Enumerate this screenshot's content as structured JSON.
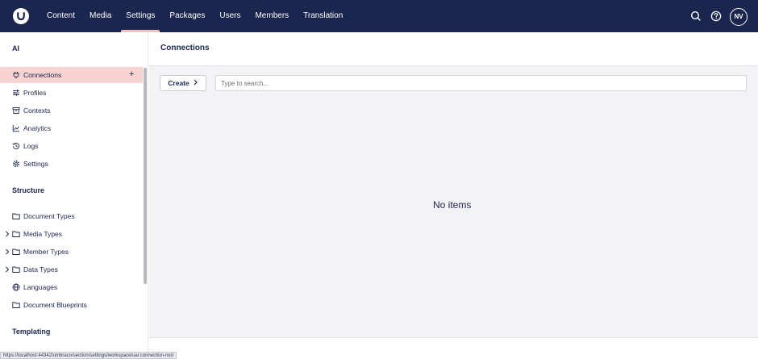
{
  "topbar": {
    "nav": [
      {
        "label": "Content",
        "active": false
      },
      {
        "label": "Media",
        "active": false
      },
      {
        "label": "Settings",
        "active": true
      },
      {
        "label": "Packages",
        "active": false
      },
      {
        "label": "Users",
        "active": false
      },
      {
        "label": "Members",
        "active": false
      },
      {
        "label": "Translation",
        "active": false
      }
    ],
    "icons": [
      "search-icon",
      "help-icon"
    ],
    "avatar_initials": "NV",
    "colors": {
      "background": "#1b264f",
      "active_indicator": "#f5c1bc"
    }
  },
  "sidebar": {
    "ai": {
      "title": "AI",
      "items": [
        {
          "label": "Connections",
          "icon": "plug-icon",
          "active": true
        },
        {
          "label": "Profiles",
          "icon": "sliders-icon",
          "active": false
        },
        {
          "label": "Contexts",
          "icon": "archive-icon",
          "active": false
        },
        {
          "label": "Analytics",
          "icon": "chart-line-icon",
          "active": false
        },
        {
          "label": "Logs",
          "icon": "history-icon",
          "active": false
        },
        {
          "label": "Settings",
          "icon": "gear-icon",
          "active": false
        }
      ]
    },
    "structure": {
      "title": "Structure",
      "items": [
        {
          "label": "Document Types",
          "icon": "folder-icon",
          "expandable": false
        },
        {
          "label": "Media Types",
          "icon": "folder-icon",
          "expandable": true
        },
        {
          "label": "Member Types",
          "icon": "folder-icon",
          "expandable": true
        },
        {
          "label": "Data Types",
          "icon": "folder-icon",
          "expandable": true
        },
        {
          "label": "Languages",
          "icon": "globe-icon",
          "expandable": false
        },
        {
          "label": "Document Blueprints",
          "icon": "folder-icon",
          "expandable": false
        }
      ]
    },
    "templating": {
      "title": "Templating"
    },
    "colors": {
      "active_item": "#f6d3d0"
    }
  },
  "main": {
    "title": "Connections",
    "create_label": "Create",
    "search_placeholder": "Type to search...",
    "empty_text": "No items"
  },
  "status_bar": {
    "url": "https://localhost:44342/umbraco/section/settings/workspace/uai:connection-root"
  }
}
